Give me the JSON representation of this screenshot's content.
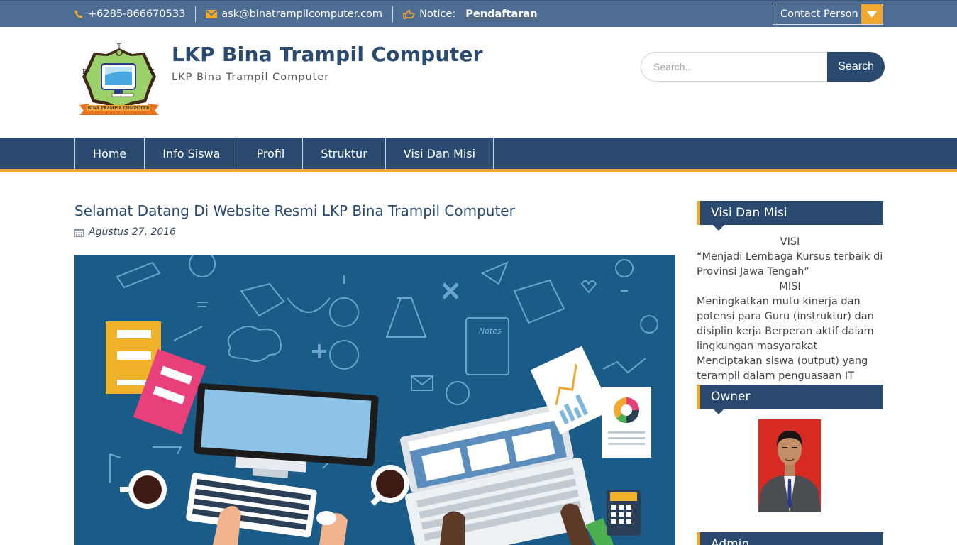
{
  "topbar": {
    "phone": "+6285-866670533",
    "email": "ask@binatrampilcomputer.com",
    "notice_label": "Notice:",
    "notice_link": "Pendaftaran",
    "contact_label": "Contact Person",
    "accent_color": "#f0a830"
  },
  "header": {
    "site_title": "LKP Bina Trampil Computer",
    "site_description": "LKP Bina Trampil Computer",
    "logo_text": "BINA TRAMPIL COMPUTER",
    "logo_letters": [
      "T",
      "B",
      "C"
    ]
  },
  "search": {
    "placeholder": "Search...",
    "button_label": "Search"
  },
  "nav": {
    "items": [
      {
        "label": "Home"
      },
      {
        "label": "Info Siswa"
      },
      {
        "label": "Profil"
      },
      {
        "label": "Struktur"
      },
      {
        "label": "Visi Dan Misi"
      }
    ]
  },
  "post": {
    "title": "Selamat Datang Di Website Resmi LKP Bina Trampil Computer",
    "date": "Agustus 27, 2016",
    "image_notes_label": "Notes"
  },
  "sidebar": {
    "visi_misi": {
      "title": "Visi Dan Misi",
      "visi_heading": "VISI",
      "visi_text": "“Menjadi Lembaga Kursus terbaik di Provinsi Jawa Tengah”",
      "misi_heading": "MISI",
      "misi_text": "Meningkatkan mutu kinerja dan potensi para Guru (instruktur) dan disiplin kerja Berperan aktif dalam lingkungan masyarakat Menciptakan siswa (output) yang terampil dalam penguasaan IT"
    },
    "owner": {
      "title": "Owner"
    },
    "admin": {
      "title": "Admin"
    }
  },
  "colors": {
    "primary": "#2a4a6f",
    "topbar": "#4e6d92",
    "accent": "#f0a830"
  }
}
